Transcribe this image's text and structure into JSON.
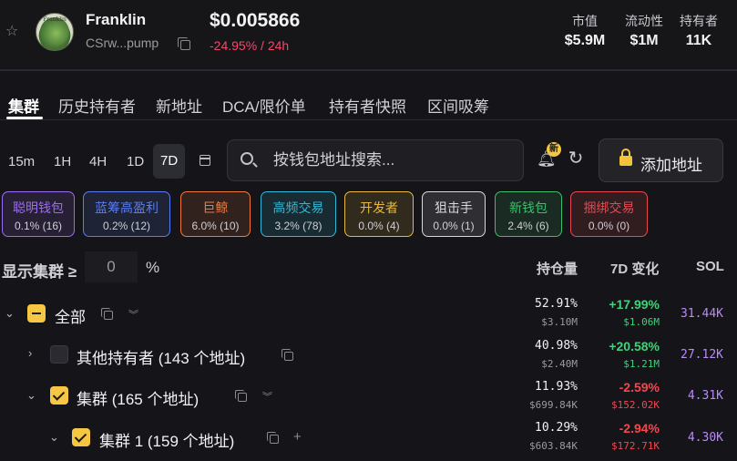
{
  "token": {
    "name": "Franklin",
    "avatar_text": "Franklin",
    "address_short": "CSrw...pump",
    "price": "$0.005866",
    "change_24h": "-24.95% / 24h"
  },
  "stats": [
    {
      "label": "市值",
      "value": "$5.9M"
    },
    {
      "label": "流动性",
      "value": "$1M"
    },
    {
      "label": "持有者",
      "value": "11K"
    }
  ],
  "tabs": [
    "集群",
    "历史持有者",
    "新地址",
    "DCA/限价单",
    "持有者快照",
    "区间吸筹"
  ],
  "time_filters": [
    "15m",
    "1H",
    "4H",
    "1D",
    "7D"
  ],
  "search": {
    "placeholder": "按钱包地址搜索..."
  },
  "notification_badge": "新",
  "add_address_label": "添加地址",
  "tags": [
    {
      "title": "聪明钱包",
      "value": "0.1% (16)",
      "color": "#9b6cf0"
    },
    {
      "title": "蓝筹高盈利",
      "value": "0.2% (12)",
      "color": "#5b7cf0"
    },
    {
      "title": "巨鲸",
      "value": "6.0% (10)",
      "color": "#f07a3c"
    },
    {
      "title": "高频交易",
      "value": "3.2% (78)",
      "color": "#2fb8d8"
    },
    {
      "title": "开发者",
      "value": "0.0% (4)",
      "color": "#e8b83a"
    },
    {
      "title": "狙击手",
      "value": "0.0% (1)",
      "color": "#d8d8de"
    },
    {
      "title": "新钱包",
      "value": "2.4% (6)",
      "color": "#3cbf6a"
    },
    {
      "title": "捆绑交易",
      "value": "0.0% (0)",
      "color": "#e84850"
    }
  ],
  "filter": {
    "label": "显示集群 ≥",
    "value": "0",
    "unit": "%"
  },
  "columns": {
    "holding": "持仓量",
    "change": "7D 变化",
    "sol": "SOL"
  },
  "rows": [
    {
      "label": "全部",
      "hold_pct": "52.91%",
      "hold_usd": "$3.10M",
      "chg": "+17.99%",
      "chg_usd": "$1.06M",
      "sol": "31.44K"
    },
    {
      "label": "其他持有者 (143 个地址)",
      "hold_pct": "40.98%",
      "hold_usd": "$2.40M",
      "chg": "+20.58%",
      "chg_usd": "$1.21M",
      "sol": "27.12K"
    },
    {
      "label": "集群 (165 个地址)",
      "hold_pct": "11.93%",
      "hold_usd": "$699.84K",
      "chg": "-2.59%",
      "chg_usd": "$152.02K",
      "sol": "4.31K"
    },
    {
      "label": "集群 1 (159 个地址)",
      "hold_pct": "10.29%",
      "hold_usd": "$603.84K",
      "chg": "-2.94%",
      "chg_usd": "$172.71K",
      "sol": "4.30K"
    }
  ]
}
